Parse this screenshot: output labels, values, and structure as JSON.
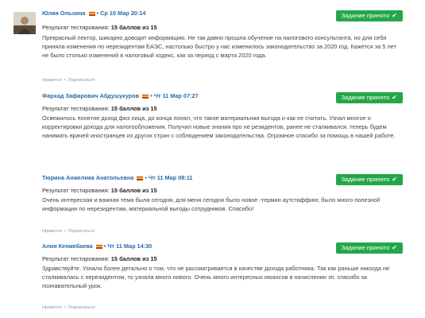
{
  "reviews": [
    {
      "name": "Юлия Ольхина",
      "date": "Ср 10 Мар 20:14",
      "badge": "Задание принято",
      "result_label": "Результат тестирования:",
      "score": "15 баллов из 15",
      "text": "Прекрасный лектор, шикарно доводит информацию. Не так давно прошла обучение на налогового консультанта, но для себя приняла изменения по нерезидентам ЕАЭС, настолько быстро у нас изменилось законодательство за 2020 год. Кажется за 5 лет не было столько изменений в налоговый кодекс, как за период с марта 2020 года.",
      "like": "Нравится",
      "subscribe": "Подписаться"
    },
    {
      "name": "Фархад Зафарович Абдушукуров",
      "date": "Чт 11 Мар 07:27",
      "badge": "Задание принято",
      "result_label": "Результат тестирования:",
      "score": "15 баллов из 15",
      "text": "Освежилось понятие доход физ лица, до конца понял, что такое материальная выгода и как ее считать. Узнал многое о корректировки дохода для налогообложения. Получил новые знания про не резидентов, ранее не сталкивался. теперь будем нанимать врачей иностранцев из других стран с соблюдением законодательства. Огромное спасибо за помощь в нашей работе."
    },
    {
      "name": "Тюрина Анжелика Анатольевна",
      "date": "Чт 11 Мар 08:11",
      "badge": "Задание принято",
      "result_label": "Результат тестирования:",
      "score": "15 баллов из 15",
      "text": "Очень интересная и важная тема была сегодня, для меня сегодня было новое -термин аутстаффинг, было много полезной информации по нерезидентам, материальной выгоды сотрудников. Спасибо!",
      "like": "Нравится",
      "subscribe": "Подписаться"
    },
    {
      "name": "Алия Кенжебаева",
      "date": "Чт 11 Мар 14:30",
      "badge": "Задание принято",
      "result_label": "Результат тестирования:",
      "score": "15 баллов из 15",
      "text": "Здравствуйте. Узнала более детально о том, что не рассматривается в качестве дохода работника. Так как раньше никогда не сталкивалась с нерезидентом, то узнала много нового. Очень много интересных нюансов в начислении зп. спасибо за познавательный урок.",
      "like": "Нравится",
      "subscribe": "Подписаться"
    }
  ],
  "icons": {
    "badge_check": "check-icon",
    "flag": "flag-icon"
  },
  "colors": {
    "accent": "#24a748",
    "name": "#2b6aa7"
  }
}
